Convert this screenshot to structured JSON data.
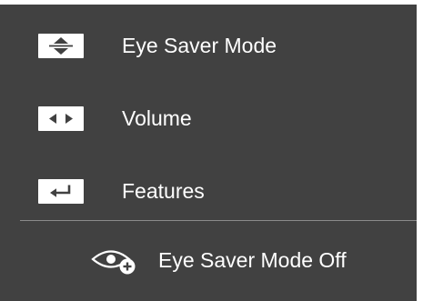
{
  "menu": {
    "items": [
      {
        "icon": "up-down-arrows-icon",
        "label": "Eye Saver Mode"
      },
      {
        "icon": "left-right-arrows-icon",
        "label": "Volume"
      },
      {
        "icon": "enter-return-icon",
        "label": "Features"
      }
    ]
  },
  "status": {
    "icon": "eye-saver-icon",
    "label": "Eye Saver Mode Off"
  },
  "colors": {
    "panel_background": "#414141",
    "key_background": "#ffffff",
    "text": "#ffffff",
    "divider": "#8a8a8a"
  }
}
